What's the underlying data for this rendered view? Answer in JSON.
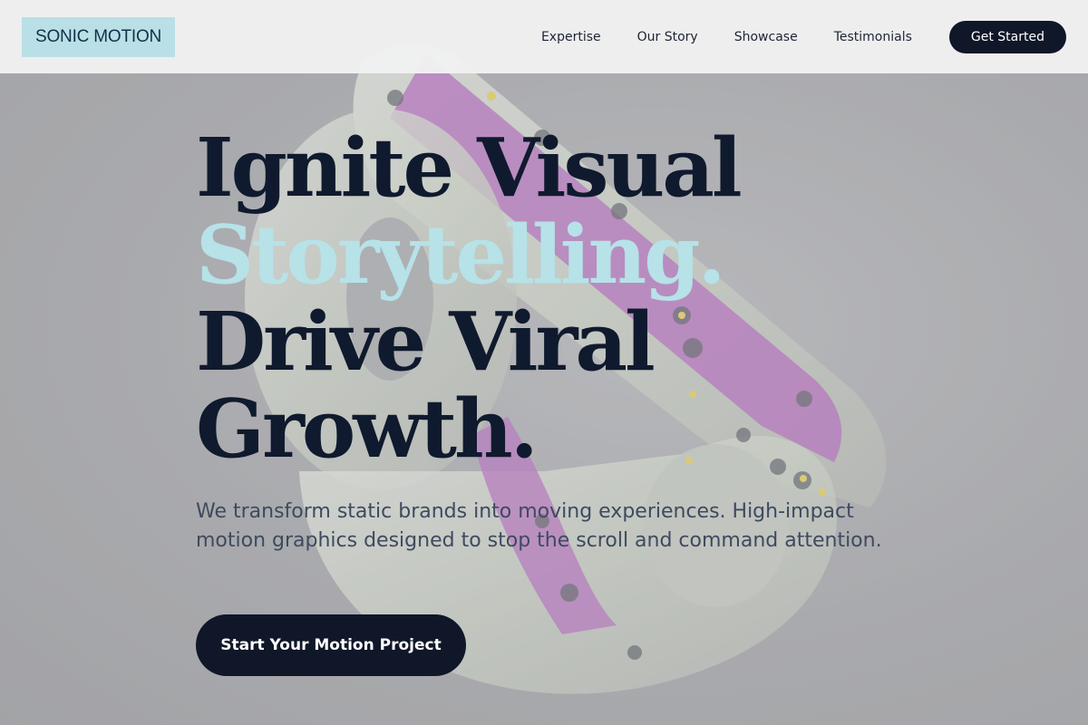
{
  "header": {
    "logo_text": "SONIC MOTION",
    "nav": [
      {
        "label": "Expertise"
      },
      {
        "label": "Our Story"
      },
      {
        "label": "Showcase"
      },
      {
        "label": "Testimonials"
      }
    ],
    "cta_label": "Get Started"
  },
  "hero": {
    "headline_line1": "Ignite Visual",
    "headline_line2": "Storytelling.",
    "headline_line3": "Drive Viral",
    "headline_line4": "Growth.",
    "subcopy": "We transform static brands into moving experiences. High-impact motion graphics designed to stop the scroll and command attention.",
    "cta_label": "Start Your Motion Project"
  },
  "colors": {
    "navy": "#0f1729",
    "accent_cyan": "#b6e2e8",
    "logo_bg": "#b9e0e6",
    "overlay_gray": "#a9aaad"
  }
}
